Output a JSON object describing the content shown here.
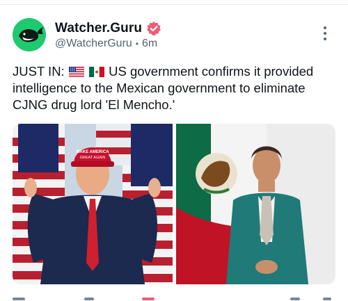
{
  "post": {
    "author": {
      "display_name": "Watcher.Guru",
      "handle": "@WatcherGuru",
      "separator": "•",
      "time": "6m",
      "verified": true,
      "avatar_icon": "whale-icon",
      "avatar_color": "#1fc970",
      "verified_color": "#f15b77"
    },
    "text": {
      "prefix": "JUST IN:",
      "flags": [
        "us-flag-icon",
        "mexico-flag-icon"
      ],
      "body": "US government confirms it provided intelligence to the Mexican government to eliminate CJNG drug lord 'El Mencho.'"
    },
    "media": {
      "images": [
        {
          "icon": "photo-man-red-cap-us-flags",
          "cap_text": "MAKE AMERICA GREAT AGAIN"
        },
        {
          "icon": "photo-woman-teal-suit-mexico-flag"
        }
      ]
    },
    "actions": [
      "reply-icon",
      "repost-icon",
      "like-icon",
      "bookmark-icon",
      "share-icon"
    ]
  }
}
